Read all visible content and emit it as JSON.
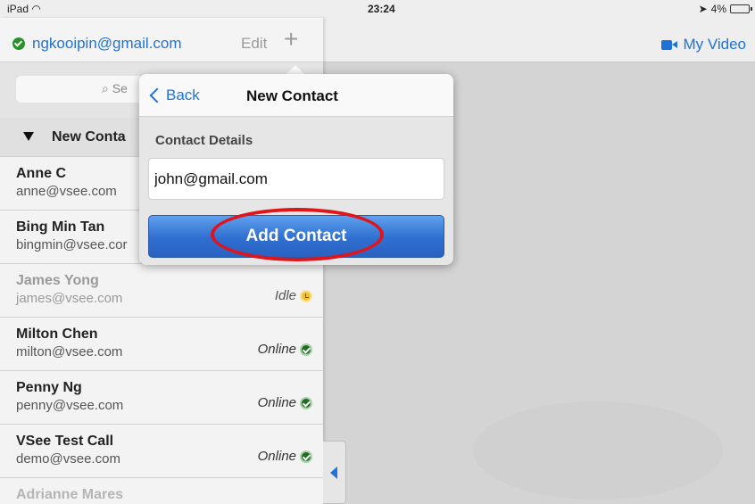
{
  "status_bar": {
    "device": "iPad",
    "time": "23:24",
    "battery": "4%"
  },
  "header": {
    "account_email": "ngkooipin@gmail.com",
    "edit_label": "Edit",
    "add_label": "+",
    "my_video_label": "My Video"
  },
  "search": {
    "placeholder": "Se"
  },
  "group": {
    "label": "New Conta"
  },
  "contacts": [
    {
      "name": "Anne C",
      "email": "anne@vsee.com",
      "status": ""
    },
    {
      "name": "Bing Min Tan",
      "email": "bingmin@vsee.cor",
      "status": ""
    },
    {
      "name": "James Yong",
      "email": "james@vsee.com",
      "status": "Idle"
    },
    {
      "name": "Milton Chen",
      "email": "milton@vsee.com",
      "status": "Online"
    },
    {
      "name": "Penny Ng",
      "email": "penny@vsee.com",
      "status": "Online"
    },
    {
      "name": "VSee Test Call",
      "email": "demo@vsee.com",
      "status": "Online"
    },
    {
      "name": "Adrianne Mares",
      "email": "",
      "status": ""
    }
  ],
  "popover": {
    "back_label": "Back",
    "title": "New Contact",
    "section_label": "Contact Details",
    "email_value": "john@gmail.com",
    "add_button_label": "Add Contact"
  },
  "colors": {
    "accent": "#1e73d8",
    "highlight": "#e0141b",
    "online": "#1f6d22",
    "idle": "#f2c230"
  },
  "icons": [
    "wifi-icon",
    "location-arrow-icon",
    "battery-icon",
    "online-status-icon",
    "video-camera-icon",
    "plus-icon",
    "search-icon",
    "disclosure-triangle-icon",
    "idle-clock-icon",
    "chevron-left-icon"
  ]
}
